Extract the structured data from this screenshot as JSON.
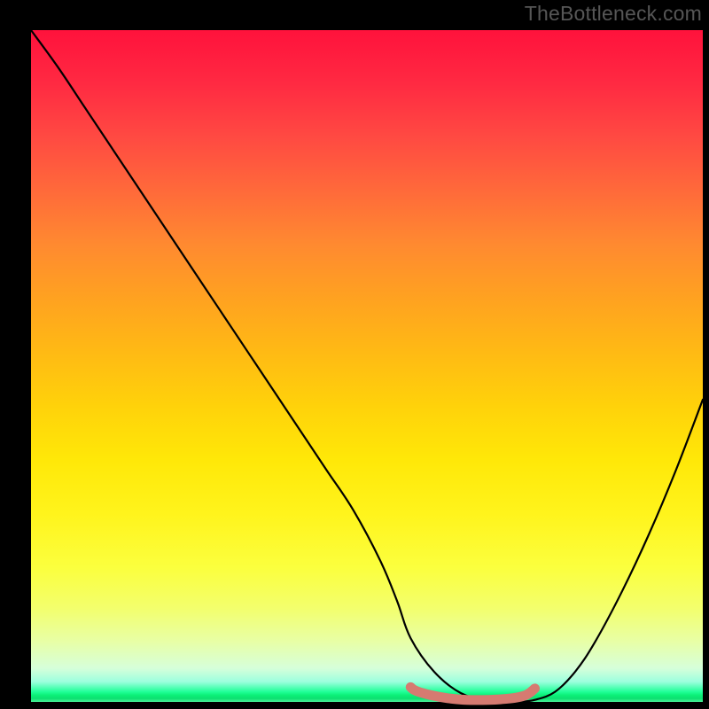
{
  "watermark": "TheBottleneck.com",
  "chart_data": {
    "type": "line",
    "title": "",
    "xlabel": "",
    "ylabel": "",
    "xlim": [
      0,
      100
    ],
    "ylim": [
      0,
      100
    ],
    "grid": false,
    "series": [
      {
        "name": "curve",
        "color": "#000000",
        "x": [
          0,
          4,
          8,
          12,
          16,
          20,
          24,
          28,
          32,
          36,
          40,
          44,
          48,
          52,
          54.5,
          56.5,
          60,
          64,
          68,
          70.5,
          72.5,
          75,
          78,
          81,
          84,
          88,
          92,
          96,
          100
        ],
        "y": [
          100,
          94.5,
          88.5,
          82.5,
          76.5,
          70.5,
          64.5,
          58.5,
          52.5,
          46.5,
          40.5,
          34.5,
          28.5,
          21,
          15,
          9.5,
          4.5,
          1.3,
          0.2,
          0,
          0,
          0.3,
          1.5,
          4.5,
          9,
          16.5,
          25,
          34.5,
          45
        ]
      },
      {
        "name": "highlight",
        "color": "#d67a71",
        "x": [
          56.5,
          57,
          58,
          60,
          62,
          64,
          66,
          68,
          70,
          72,
          73.5,
          74.3,
          75
        ],
        "y": [
          2.2,
          1.8,
          1.4,
          0.9,
          0.55,
          0.35,
          0.28,
          0.3,
          0.4,
          0.6,
          0.95,
          1.4,
          2.0
        ]
      }
    ]
  }
}
